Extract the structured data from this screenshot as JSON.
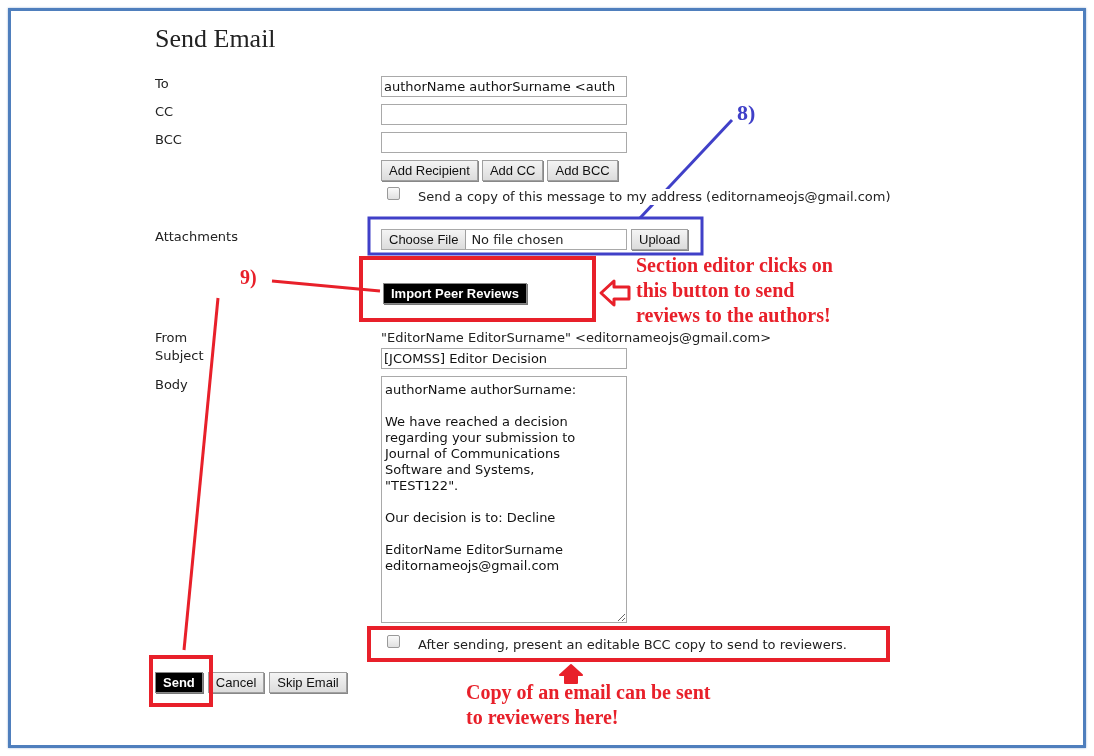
{
  "title": "Send Email",
  "to": {
    "label": "To",
    "value": "authorName authorSurname <auth"
  },
  "cc": {
    "label": "CC"
  },
  "bcc": {
    "label": "BCC"
  },
  "recipient_buttons": [
    "Add Recipient",
    "Add CC",
    "Add BCC"
  ],
  "copy_to_me": {
    "label": "Send a copy of this message to my address (editornameojs@gmail.com)",
    "checked": false
  },
  "attachments": {
    "label": "Attachments",
    "choose_button": "Choose File",
    "file_status": "No file chosen",
    "upload_button": "Upload"
  },
  "import_button": "Import Peer Reviews",
  "from": {
    "label": "From",
    "value": "\"EditorName EditorSurname\" <editornameojs@gmail.com>"
  },
  "subject": {
    "label": "Subject",
    "value": "[JCOMSS] Editor Decision"
  },
  "body": {
    "label": "Body",
    "value": "authorName authorSurname:\n\nWe have reached a decision regarding your submission to Journal of Communications Software and Systems, \"TEST122\".\n\nOur decision is to: Decline\n\nEditorName EditorSurname\neditornameojs@gmail.com"
  },
  "bcc_reviewers": {
    "label": "After sending, present an editable BCC copy to send to reviewers.",
    "checked": false
  },
  "actions": [
    {
      "label": "Send",
      "primary": true
    },
    {
      "label": "Cancel",
      "primary": false
    },
    {
      "label": "Skip Email",
      "primary": false
    }
  ],
  "annotations": {
    "marker_attachments": "8)",
    "marker_import": "9)",
    "note_import": "Section editor clicks on\nthis button to send\nreviews to the authors!",
    "note_bcc": "Copy of an email can be sent\nto reviewers here!"
  }
}
